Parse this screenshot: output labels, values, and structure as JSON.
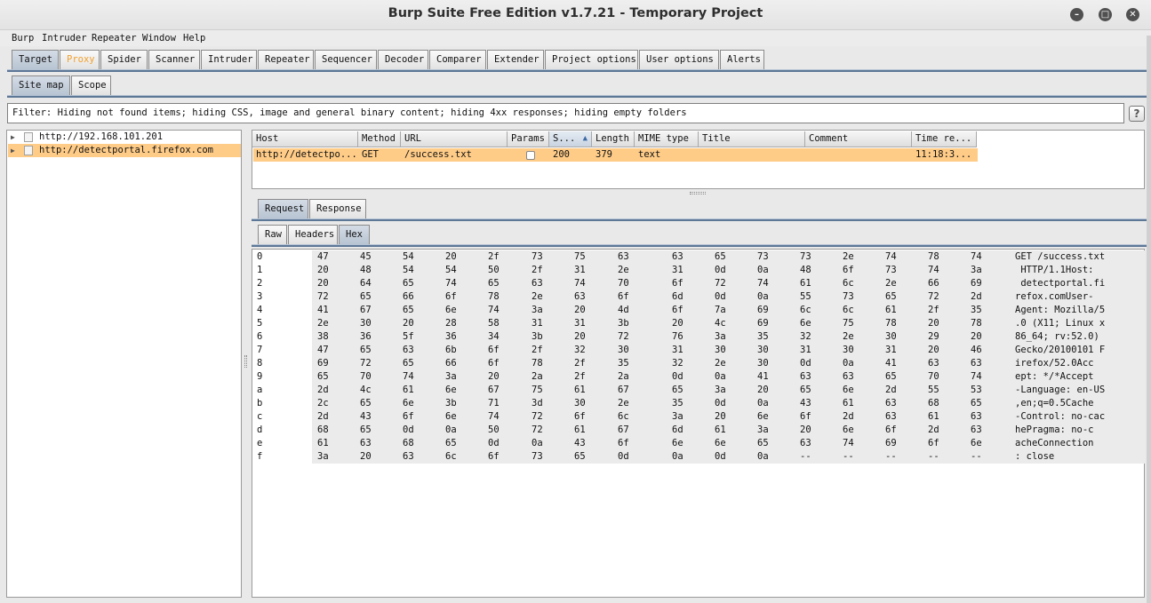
{
  "window": {
    "title": "Burp Suite Free Edition v1.7.21 - Temporary Project"
  },
  "menu": [
    "Burp",
    "Intruder",
    "Repeater",
    "Window",
    "Help"
  ],
  "main_tabs": [
    "Target",
    "Proxy",
    "Spider",
    "Scanner",
    "Intruder",
    "Repeater",
    "Sequencer",
    "Decoder",
    "Comparer",
    "Extender",
    "Project options",
    "User options",
    "Alerts"
  ],
  "active_main_tab": "Target",
  "target_tabs": [
    "Site map",
    "Scope"
  ],
  "filter_text": "Filter: Hiding not found items;  hiding CSS, image and general binary content;  hiding 4xx responses;  hiding empty folders",
  "help_label": "?",
  "tree": [
    {
      "label": "http://192.168.101.201",
      "selected": false
    },
    {
      "label": "http://detectportal.firefox.com",
      "selected": true
    }
  ],
  "table": {
    "columns": [
      "Host",
      "Method",
      "URL",
      "Params",
      "S...",
      "Length",
      "MIME type",
      "Title",
      "Comment",
      "Time re..."
    ],
    "sort_indicator": "▲",
    "row": {
      "host": "http://detectpo...",
      "method": "GET",
      "url": "/success.txt",
      "params": false,
      "status": "200",
      "length": "379",
      "mime": "text",
      "title": "",
      "comment": "",
      "time": "11:18:3..."
    }
  },
  "message_tabs": [
    "Request",
    "Response"
  ],
  "view_tabs": [
    "Raw",
    "Headers",
    "Hex"
  ],
  "hex_rows": [
    {
      "i": "0",
      "b": [
        "47",
        "45",
        "54",
        "20",
        "2f",
        "73",
        "75",
        "63",
        "63",
        "65",
        "73",
        "73",
        "2e",
        "74",
        "78",
        "74"
      ],
      "a": "GET /success.txt"
    },
    {
      "i": "1",
      "b": [
        "20",
        "48",
        "54",
        "54",
        "50",
        "2f",
        "31",
        "2e",
        "31",
        "0d",
        "0a",
        "48",
        "6f",
        "73",
        "74",
        "3a"
      ],
      "a": " HTTP/1.1Host:"
    },
    {
      "i": "2",
      "b": [
        "20",
        "64",
        "65",
        "74",
        "65",
        "63",
        "74",
        "70",
        "6f",
        "72",
        "74",
        "61",
        "6c",
        "2e",
        "66",
        "69"
      ],
      "a": " detectportal.fi"
    },
    {
      "i": "3",
      "b": [
        "72",
        "65",
        "66",
        "6f",
        "78",
        "2e",
        "63",
        "6f",
        "6d",
        "0d",
        "0a",
        "55",
        "73",
        "65",
        "72",
        "2d"
      ],
      "a": "refox.comUser-"
    },
    {
      "i": "4",
      "b": [
        "41",
        "67",
        "65",
        "6e",
        "74",
        "3a",
        "20",
        "4d",
        "6f",
        "7a",
        "69",
        "6c",
        "6c",
        "61",
        "2f",
        "35"
      ],
      "a": "Agent: Mozilla/5"
    },
    {
      "i": "5",
      "b": [
        "2e",
        "30",
        "20",
        "28",
        "58",
        "31",
        "31",
        "3b",
        "20",
        "4c",
        "69",
        "6e",
        "75",
        "78",
        "20",
        "78"
      ],
      "a": ".0 (X11; Linux x"
    },
    {
      "i": "6",
      "b": [
        "38",
        "36",
        "5f",
        "36",
        "34",
        "3b",
        "20",
        "72",
        "76",
        "3a",
        "35",
        "32",
        "2e",
        "30",
        "29",
        "20"
      ],
      "a": "86_64; rv:52.0)"
    },
    {
      "i": "7",
      "b": [
        "47",
        "65",
        "63",
        "6b",
        "6f",
        "2f",
        "32",
        "30",
        "31",
        "30",
        "30",
        "31",
        "30",
        "31",
        "20",
        "46"
      ],
      "a": "Gecko/20100101 F"
    },
    {
      "i": "8",
      "b": [
        "69",
        "72",
        "65",
        "66",
        "6f",
        "78",
        "2f",
        "35",
        "32",
        "2e",
        "30",
        "0d",
        "0a",
        "41",
        "63",
        "63"
      ],
      "a": "irefox/52.0Acc"
    },
    {
      "i": "9",
      "b": [
        "65",
        "70",
        "74",
        "3a",
        "20",
        "2a",
        "2f",
        "2a",
        "0d",
        "0a",
        "41",
        "63",
        "63",
        "65",
        "70",
        "74"
      ],
      "a": "ept: */*Accept"
    },
    {
      "i": "a",
      "b": [
        "2d",
        "4c",
        "61",
        "6e",
        "67",
        "75",
        "61",
        "67",
        "65",
        "3a",
        "20",
        "65",
        "6e",
        "2d",
        "55",
        "53"
      ],
      "a": "-Language: en-US"
    },
    {
      "i": "b",
      "b": [
        "2c",
        "65",
        "6e",
        "3b",
        "71",
        "3d",
        "30",
        "2e",
        "35",
        "0d",
        "0a",
        "43",
        "61",
        "63",
        "68",
        "65"
      ],
      "a": ",en;q=0.5Cache"
    },
    {
      "i": "c",
      "b": [
        "2d",
        "43",
        "6f",
        "6e",
        "74",
        "72",
        "6f",
        "6c",
        "3a",
        "20",
        "6e",
        "6f",
        "2d",
        "63",
        "61",
        "63"
      ],
      "a": "-Control: no-cac"
    },
    {
      "i": "d",
      "b": [
        "68",
        "65",
        "0d",
        "0a",
        "50",
        "72",
        "61",
        "67",
        "6d",
        "61",
        "3a",
        "20",
        "6e",
        "6f",
        "2d",
        "63"
      ],
      "a": "hePragma: no-c"
    },
    {
      "i": "e",
      "b": [
        "61",
        "63",
        "68",
        "65",
        "0d",
        "0a",
        "43",
        "6f",
        "6e",
        "6e",
        "65",
        "63",
        "74",
        "69",
        "6f",
        "6e"
      ],
      "a": "acheConnection"
    },
    {
      "i": "f",
      "b": [
        "3a",
        "20",
        "63",
        "6c",
        "6f",
        "73",
        "65",
        "0d",
        "0a",
        "0d",
        "0a",
        "--",
        "--",
        "--",
        "--",
        "--"
      ],
      "a": ": close"
    }
  ],
  "colors": {
    "selection": "#ffcc88",
    "proxy_tab_text": "#f3a12c",
    "accent_line": "#5d7796"
  }
}
